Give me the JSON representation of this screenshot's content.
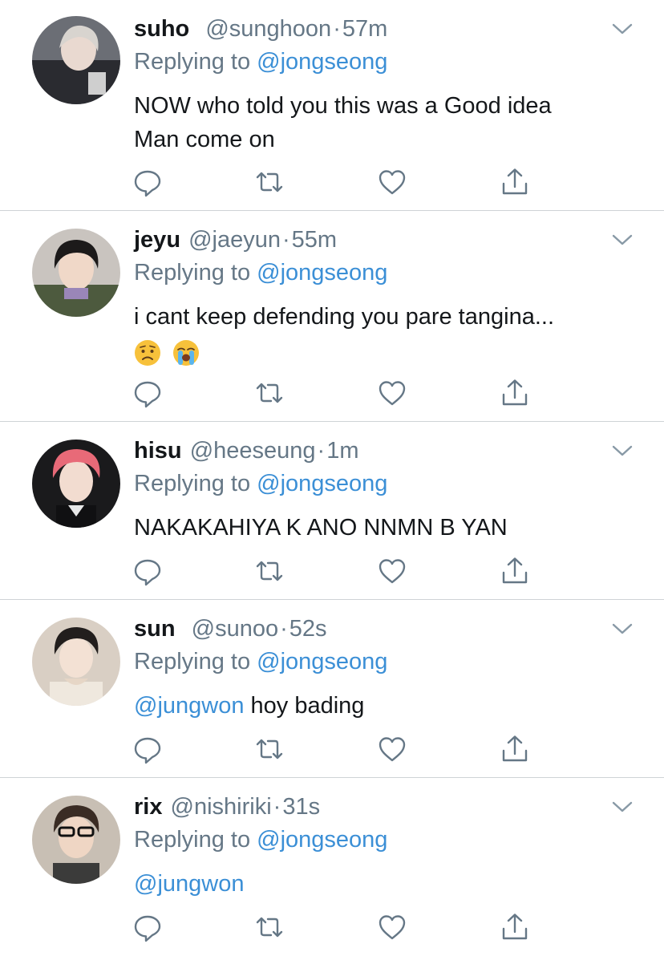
{
  "tweets": [
    {
      "name": "suho",
      "handle": "@sunghoon",
      "time": "57m",
      "replying_prefix": "Replying to",
      "replying_to": "@jongseong",
      "lines": [
        "NOW who told you this was a Good idea",
        "Man come on"
      ]
    },
    {
      "name": "jeyu",
      "handle": "@jaeyun",
      "time": "55m",
      "replying_prefix": "Replying to",
      "replying_to": "@jongseong",
      "lines": [
        "i cant keep defending you pare tangina..."
      ],
      "emojis": [
        "worried-face-emoji",
        "loudly-crying-face-emoji"
      ]
    },
    {
      "name": "hisu",
      "handle": "@heeseung",
      "time": "1m",
      "replying_prefix": "Replying to",
      "replying_to": "@jongseong",
      "lines": [
        "NAKAKAHIYA K ANO NNMN B YAN"
      ]
    },
    {
      "name": "sun",
      "handle": "@sunoo",
      "time": "52s",
      "replying_prefix": "Replying to",
      "replying_to": "@jongseong",
      "mention": "@jungwon",
      "text": " hoy bading"
    },
    {
      "name": "rix",
      "handle": "@nishiriki",
      "time": "31s",
      "replying_prefix": "Replying to",
      "replying_to": "@jongseong",
      "mention": "@jungwon"
    }
  ],
  "separator": "·",
  "icons": {
    "reply": "reply-icon",
    "retweet": "retweet-icon",
    "like": "heart-icon",
    "share": "share-icon",
    "caret": "chevron-down-icon"
  },
  "colors": {
    "text": "#14171a",
    "secondary": "#657786",
    "link": "#3b8fd6",
    "divider": "#cfd3d6",
    "icon": "#657786"
  }
}
